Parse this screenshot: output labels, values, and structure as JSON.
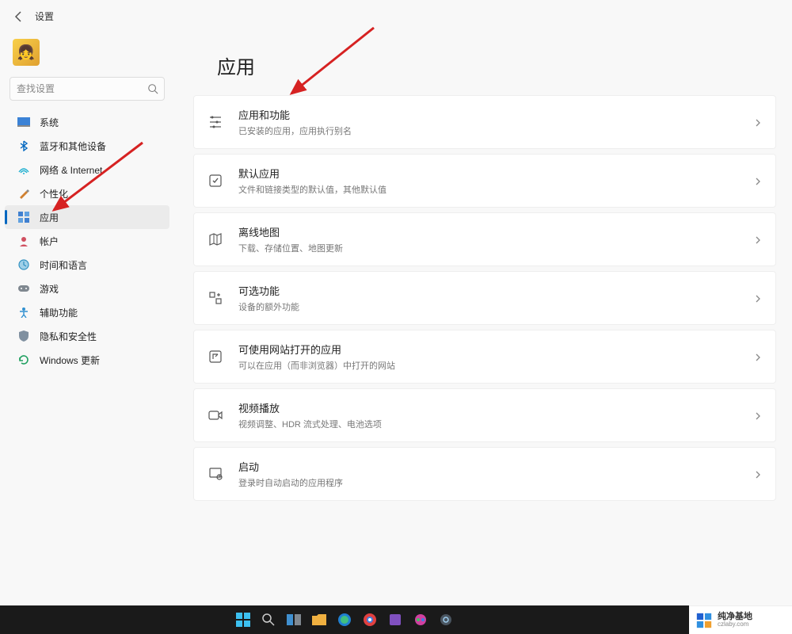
{
  "header": {
    "title": "设置"
  },
  "search": {
    "placeholder": "查找设置"
  },
  "sidebar": {
    "items": [
      {
        "label": "系统",
        "icon": "system"
      },
      {
        "label": "蓝牙和其他设备",
        "icon": "bluetooth"
      },
      {
        "label": "网络 & Internet",
        "icon": "network"
      },
      {
        "label": "个性化",
        "icon": "personalization"
      },
      {
        "label": "应用",
        "icon": "apps",
        "active": true
      },
      {
        "label": "帐户",
        "icon": "accounts"
      },
      {
        "label": "时间和语言",
        "icon": "time"
      },
      {
        "label": "游戏",
        "icon": "gaming"
      },
      {
        "label": "辅助功能",
        "icon": "accessibility"
      },
      {
        "label": "隐私和安全性",
        "icon": "privacy"
      },
      {
        "label": "Windows 更新",
        "icon": "update"
      }
    ]
  },
  "main": {
    "title": "应用",
    "cards": [
      {
        "title": "应用和功能",
        "desc": "已安装的应用，应用执行别名",
        "icon": "apps-features"
      },
      {
        "title": "默认应用",
        "desc": "文件和链接类型的默认值，其他默认值",
        "icon": "default-apps"
      },
      {
        "title": "离线地图",
        "desc": "下载、存储位置、地图更新",
        "icon": "offline-maps"
      },
      {
        "title": "可选功能",
        "desc": "设备的额外功能",
        "icon": "optional-features"
      },
      {
        "title": "可使用网站打开的应用",
        "desc": "可以在应用（而非浏览器）中打开的网站",
        "icon": "website-apps"
      },
      {
        "title": "视频播放",
        "desc": "视频调整、HDR 流式处理、电池选项",
        "icon": "video-playback"
      },
      {
        "title": "启动",
        "desc": "登录时自动启动的应用程序",
        "icon": "startup"
      }
    ]
  },
  "watermark": {
    "main": "纯净基地",
    "sub": "czlaby.com"
  }
}
